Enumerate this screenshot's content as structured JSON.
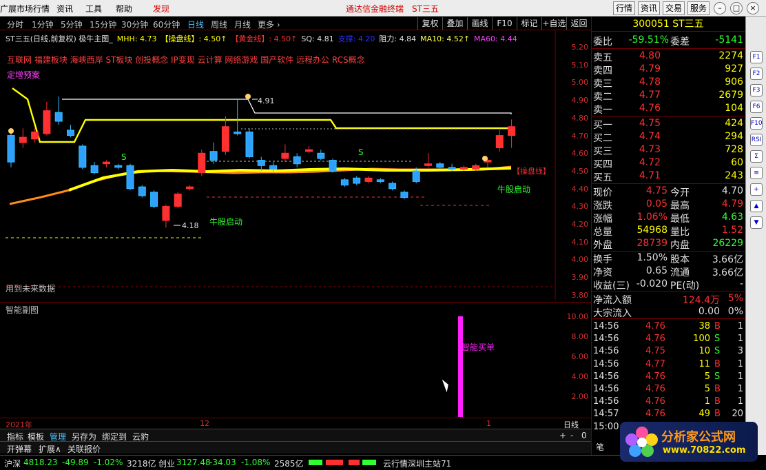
{
  "menu": {
    "items": [
      "广展市场行情",
      "资讯",
      "工具",
      "帮助"
    ],
    "active_item": "发现",
    "app_title": "通达信金融终端",
    "stock_title": "ST三五",
    "right_buttons": [
      "行情",
      "资讯",
      "交易",
      "服务"
    ]
  },
  "periods": [
    "分时",
    "1分钟",
    "5分钟",
    "15分钟",
    "30分钟",
    "60分钟",
    "日线",
    "周线",
    "月线",
    "更多 ›"
  ],
  "active_period": "日线",
  "period_right": [
    "复权",
    "叠加",
    "画线",
    "F10",
    "标记",
    "+自选",
    "返回"
  ],
  "indicator_row": [
    {
      "text": "ST三五(日线,前复权) 极牛主图_",
      "color": "#e0e0e0"
    },
    {
      "text": "MHH: 4.73",
      "color": "#ffff00"
    },
    {
      "text": "【操盘线】: 4.50↑",
      "color": "#ffff00"
    },
    {
      "text": "【黄金线】: 4.50↑",
      "color": "#ff3030"
    },
    {
      "text": "SQ: 4.81",
      "color": "#e0e0e0"
    },
    {
      "text": "支撑: 4.20",
      "color": "#3030ff"
    },
    {
      "text": "阻力: 4.84",
      "color": "#e0e0e0"
    },
    {
      "text": "MA10: 4.52↑",
      "color": "#ffff40"
    },
    {
      "text": "MA60: 4.44",
      "color": "#ff40ff"
    }
  ],
  "blocks_text": "互联网 福建板块 海峡西岸 ST板块 创投概念 IP变现 云计算 网络游戏 国产软件 远程办公 RCS概念",
  "dzyq": "定增预案",
  "main_annotations": {
    "high_label": "4.91",
    "low_label": "4.18",
    "niu1": "牛股启动",
    "niu2": "牛股启动",
    "caopan": "【操盘线】",
    "future": "用到未来数据",
    "s_mark": "S"
  },
  "main_axis": [
    "5.20",
    "5.10",
    "5.00",
    "4.90",
    "4.80",
    "4.70",
    "4.60",
    "4.50",
    "4.40",
    "4.30",
    "4.20",
    "4.10",
    "4.00",
    "3.90",
    "3.80"
  ],
  "sub": {
    "title": "智能副图",
    "signal": "智能买单",
    "axis": [
      "10.00",
      "8.00",
      "6.00",
      "4.00",
      "2.00"
    ]
  },
  "date_marks": [
    "2021年",
    "12",
    "1"
  ],
  "date_right": "日线",
  "tabs": [
    "指标",
    "模板",
    "管理",
    "另存为",
    "绑定到",
    "云豹"
  ],
  "active_tab": "管理",
  "tabs2": [
    "开弹幕",
    "扩展∧",
    "关联报价"
  ],
  "zoom_controls": [
    "+",
    "-",
    "0"
  ],
  "statusbar": {
    "sh_label": "沪深",
    "sh_index": "4818.23",
    "sh_change": "-49.89",
    "sh_pct": "-1.02%",
    "sh_amount": "3218亿",
    "cy_label": "创业",
    "cy_index": "3127.48",
    "cy_change": "-34.03",
    "cy_pct": "-1.08%",
    "cy_amount": "2585亿",
    "server": "云行情深圳主站71"
  },
  "quote": {
    "header": "300051  ST三五",
    "weibi_label": "委比",
    "weibi": "-59.51%",
    "weicha_label": "委差",
    "weicha": "-5141",
    "asks": [
      {
        "label": "卖五",
        "price": "4.80",
        "vol": "2274"
      },
      {
        "label": "卖四",
        "price": "4.79",
        "vol": "927"
      },
      {
        "label": "卖三",
        "price": "4.78",
        "vol": "906"
      },
      {
        "label": "卖二",
        "price": "4.77",
        "vol": "2679"
      },
      {
        "label": "卖一",
        "price": "4.76",
        "vol": "104"
      }
    ],
    "bids": [
      {
        "label": "买一",
        "price": "4.75",
        "vol": "424"
      },
      {
        "label": "买二",
        "price": "4.74",
        "vol": "294"
      },
      {
        "label": "买三",
        "price": "4.73",
        "vol": "728"
      },
      {
        "label": "买四",
        "price": "4.72",
        "vol": "60"
      },
      {
        "label": "买五",
        "price": "4.71",
        "vol": "243"
      }
    ],
    "stats": [
      {
        "l1": "现价",
        "v1": "4.75",
        "c1": "#ff3030",
        "l2": "今开",
        "v2": "4.70",
        "c2": "#e0e0e0"
      },
      {
        "l1": "涨跌",
        "v1": "0.05",
        "c1": "#ff3030",
        "l2": "最高",
        "v2": "4.79",
        "c2": "#ff3030"
      },
      {
        "l1": "涨幅",
        "v1": "1.06%",
        "c1": "#ff3030",
        "l2": "最低",
        "v2": "4.63",
        "c2": "#30ff30"
      },
      {
        "l1": "总量",
        "v1": "54968",
        "c1": "#ffff00",
        "l2": "量比",
        "v2": "1.52",
        "c2": "#ff3030"
      },
      {
        "l1": "外盘",
        "v1": "28739",
        "c1": "#ff3030",
        "l2": "内盘",
        "v2": "26229",
        "c2": "#30ff30"
      }
    ],
    "stats2": [
      {
        "l1": "换手",
        "v1": "1.50%",
        "l2": "股本",
        "v2": "3.66亿"
      },
      {
        "l1": "净资",
        "v1": "0.65",
        "l2": "流通",
        "v2": "3.66亿"
      },
      {
        "l1": "收益(三)",
        "v1": "-0.020",
        "l2": "PE(动)",
        "v2": "-"
      }
    ],
    "flow": [
      {
        "label": "净流入额",
        "v1": "124.4万",
        "v2": "5%",
        "c": "#ff3030"
      },
      {
        "label": "大宗流入",
        "v1": "0.00",
        "v2": "0%",
        "c": "#e0e0e0"
      }
    ],
    "ticks": [
      {
        "time": "14:56",
        "price": "4.76",
        "vol": "38",
        "bs": "B",
        "n": "1",
        "bsc": "#ff3030"
      },
      {
        "time": "14:56",
        "price": "4.76",
        "vol": "100",
        "bs": "S",
        "n": "1",
        "bsc": "#30ff30"
      },
      {
        "time": "14:56",
        "price": "4.75",
        "vol": "10",
        "bs": "S",
        "n": "3",
        "bsc": "#30ff30"
      },
      {
        "time": "14:56",
        "price": "4.77",
        "vol": "11",
        "bs": "B",
        "n": "1",
        "bsc": "#ff3030"
      },
      {
        "time": "14:56",
        "price": "4.76",
        "vol": "5",
        "bs": "S",
        "n": "1",
        "bsc": "#30ff30"
      },
      {
        "time": "14:56",
        "price": "4.76",
        "vol": "5",
        "bs": "B",
        "n": "1",
        "bsc": "#ff3030"
      },
      {
        "time": "14:56",
        "price": "4.76",
        "vol": "1",
        "bs": "B",
        "n": "1",
        "bsc": "#ff3030"
      },
      {
        "time": "14:57",
        "price": "4.76",
        "vol": "49",
        "bs": "B",
        "n": "20",
        "bsc": "#ff3030"
      },
      {
        "time": "15:00",
        "price": "",
        "vol": "",
        "bs": "",
        "n": "",
        "bsc": "#ff3030"
      }
    ],
    "bottom_tab": "笔"
  },
  "sidetool_icons": [
    "F1",
    "F2",
    "F3",
    "F6",
    "F10",
    "RSI",
    "Σ",
    "≡",
    "+",
    "▲",
    "▼"
  ],
  "badge": {
    "name": "分析家公式网",
    "url": "www.70822.com"
  },
  "candles": [
    {
      "o": 4.7,
      "c": 4.55,
      "h": 4.72,
      "l": 4.52
    },
    {
      "o": 4.66,
      "c": 4.69,
      "h": 4.74,
      "l": 4.63
    },
    {
      "o": 4.68,
      "c": 4.72,
      "h": 4.74,
      "l": 4.66
    },
    {
      "o": 4.71,
      "c": 4.84,
      "h": 4.89,
      "l": 4.7
    },
    {
      "o": 4.83,
      "c": 4.78,
      "h": 4.92,
      "l": 4.76
    },
    {
      "o": 4.73,
      "c": 4.7,
      "h": 4.76,
      "l": 4.69
    },
    {
      "o": 4.64,
      "c": 4.52,
      "h": 4.65,
      "l": 4.51
    },
    {
      "o": 4.53,
      "c": 4.49,
      "h": 4.55,
      "l": 4.48
    },
    {
      "o": 4.54,
      "c": 4.55,
      "h": 4.56,
      "l": 4.52
    },
    {
      "o": 4.53,
      "c": 4.52,
      "h": 4.54,
      "l": 4.51
    },
    {
      "o": 4.53,
      "c": 4.4,
      "h": 4.54,
      "l": 4.39
    },
    {
      "o": 4.41,
      "c": 4.36,
      "h": 4.42,
      "l": 4.35
    },
    {
      "o": 4.38,
      "c": 4.3,
      "h": 4.39,
      "l": 4.29
    },
    {
      "o": 4.22,
      "c": 4.3,
      "h": 4.31,
      "l": 4.18
    },
    {
      "o": 4.3,
      "c": 4.37,
      "h": 4.38,
      "l": 4.29
    },
    {
      "o": 4.4,
      "c": 4.41,
      "h": 4.42,
      "l": 4.39
    },
    {
      "o": 4.49,
      "c": 4.6,
      "h": 4.62,
      "l": 4.47
    },
    {
      "o": 4.61,
      "c": 4.56,
      "h": 4.66,
      "l": 4.54
    },
    {
      "o": 4.61,
      "c": 4.75,
      "h": 4.81,
      "l": 4.59
    },
    {
      "o": 4.72,
      "c": 4.71,
      "h": 4.91,
      "l": 4.7
    },
    {
      "o": 4.72,
      "c": 4.58,
      "h": 4.74,
      "l": 4.57
    },
    {
      "o": 4.56,
      "c": 4.53,
      "h": 4.58,
      "l": 4.5
    },
    {
      "o": 4.53,
      "c": 4.51,
      "h": 4.55,
      "l": 4.49
    },
    {
      "o": 4.57,
      "c": 4.6,
      "h": 4.65,
      "l": 4.55
    },
    {
      "o": 4.58,
      "c": 4.54,
      "h": 4.6,
      "l": 4.52
    },
    {
      "o": 4.61,
      "c": 4.62,
      "h": 4.64,
      "l": 4.6
    },
    {
      "o": 4.6,
      "c": 4.57,
      "h": 4.62,
      "l": 4.56
    },
    {
      "o": 4.56,
      "c": 4.5,
      "h": 4.57,
      "l": 4.49
    },
    {
      "o": 4.45,
      "c": 4.42,
      "h": 4.46,
      "l": 4.41
    },
    {
      "o": 4.46,
      "c": 4.43,
      "h": 4.47,
      "l": 4.42
    },
    {
      "o": 4.44,
      "c": 4.46,
      "h": 4.47,
      "l": 4.43
    },
    {
      "o": 4.45,
      "c": 4.44,
      "h": 4.46,
      "l": 4.43
    },
    {
      "o": 4.43,
      "c": 4.4,
      "h": 4.44,
      "l": 4.39
    },
    {
      "o": 4.38,
      "c": 4.35,
      "h": 4.39,
      "l": 4.34
    },
    {
      "o": 4.5,
      "c": 4.44,
      "h": 4.52,
      "l": 4.43
    },
    {
      "o": 4.53,
      "c": 4.54,
      "h": 4.6,
      "l": 4.52
    },
    {
      "o": 4.54,
      "c": 4.52,
      "h": 4.55,
      "l": 4.51
    },
    {
      "o": 4.52,
      "c": 4.51,
      "h": 4.54,
      "l": 4.5
    },
    {
      "o": 4.51,
      "c": 4.52,
      "h": 4.53,
      "l": 4.5
    },
    {
      "o": 4.51,
      "c": 4.53,
      "h": 4.54,
      "l": 4.5
    },
    {
      "o": 4.55,
      "c": 4.56,
      "h": 4.57,
      "l": 4.52
    },
    {
      "o": 4.63,
      "c": 4.7,
      "h": 4.73,
      "l": 4.61
    },
    {
      "o": 4.7,
      "c": 4.75,
      "h": 4.79,
      "l": 4.63
    }
  ]
}
